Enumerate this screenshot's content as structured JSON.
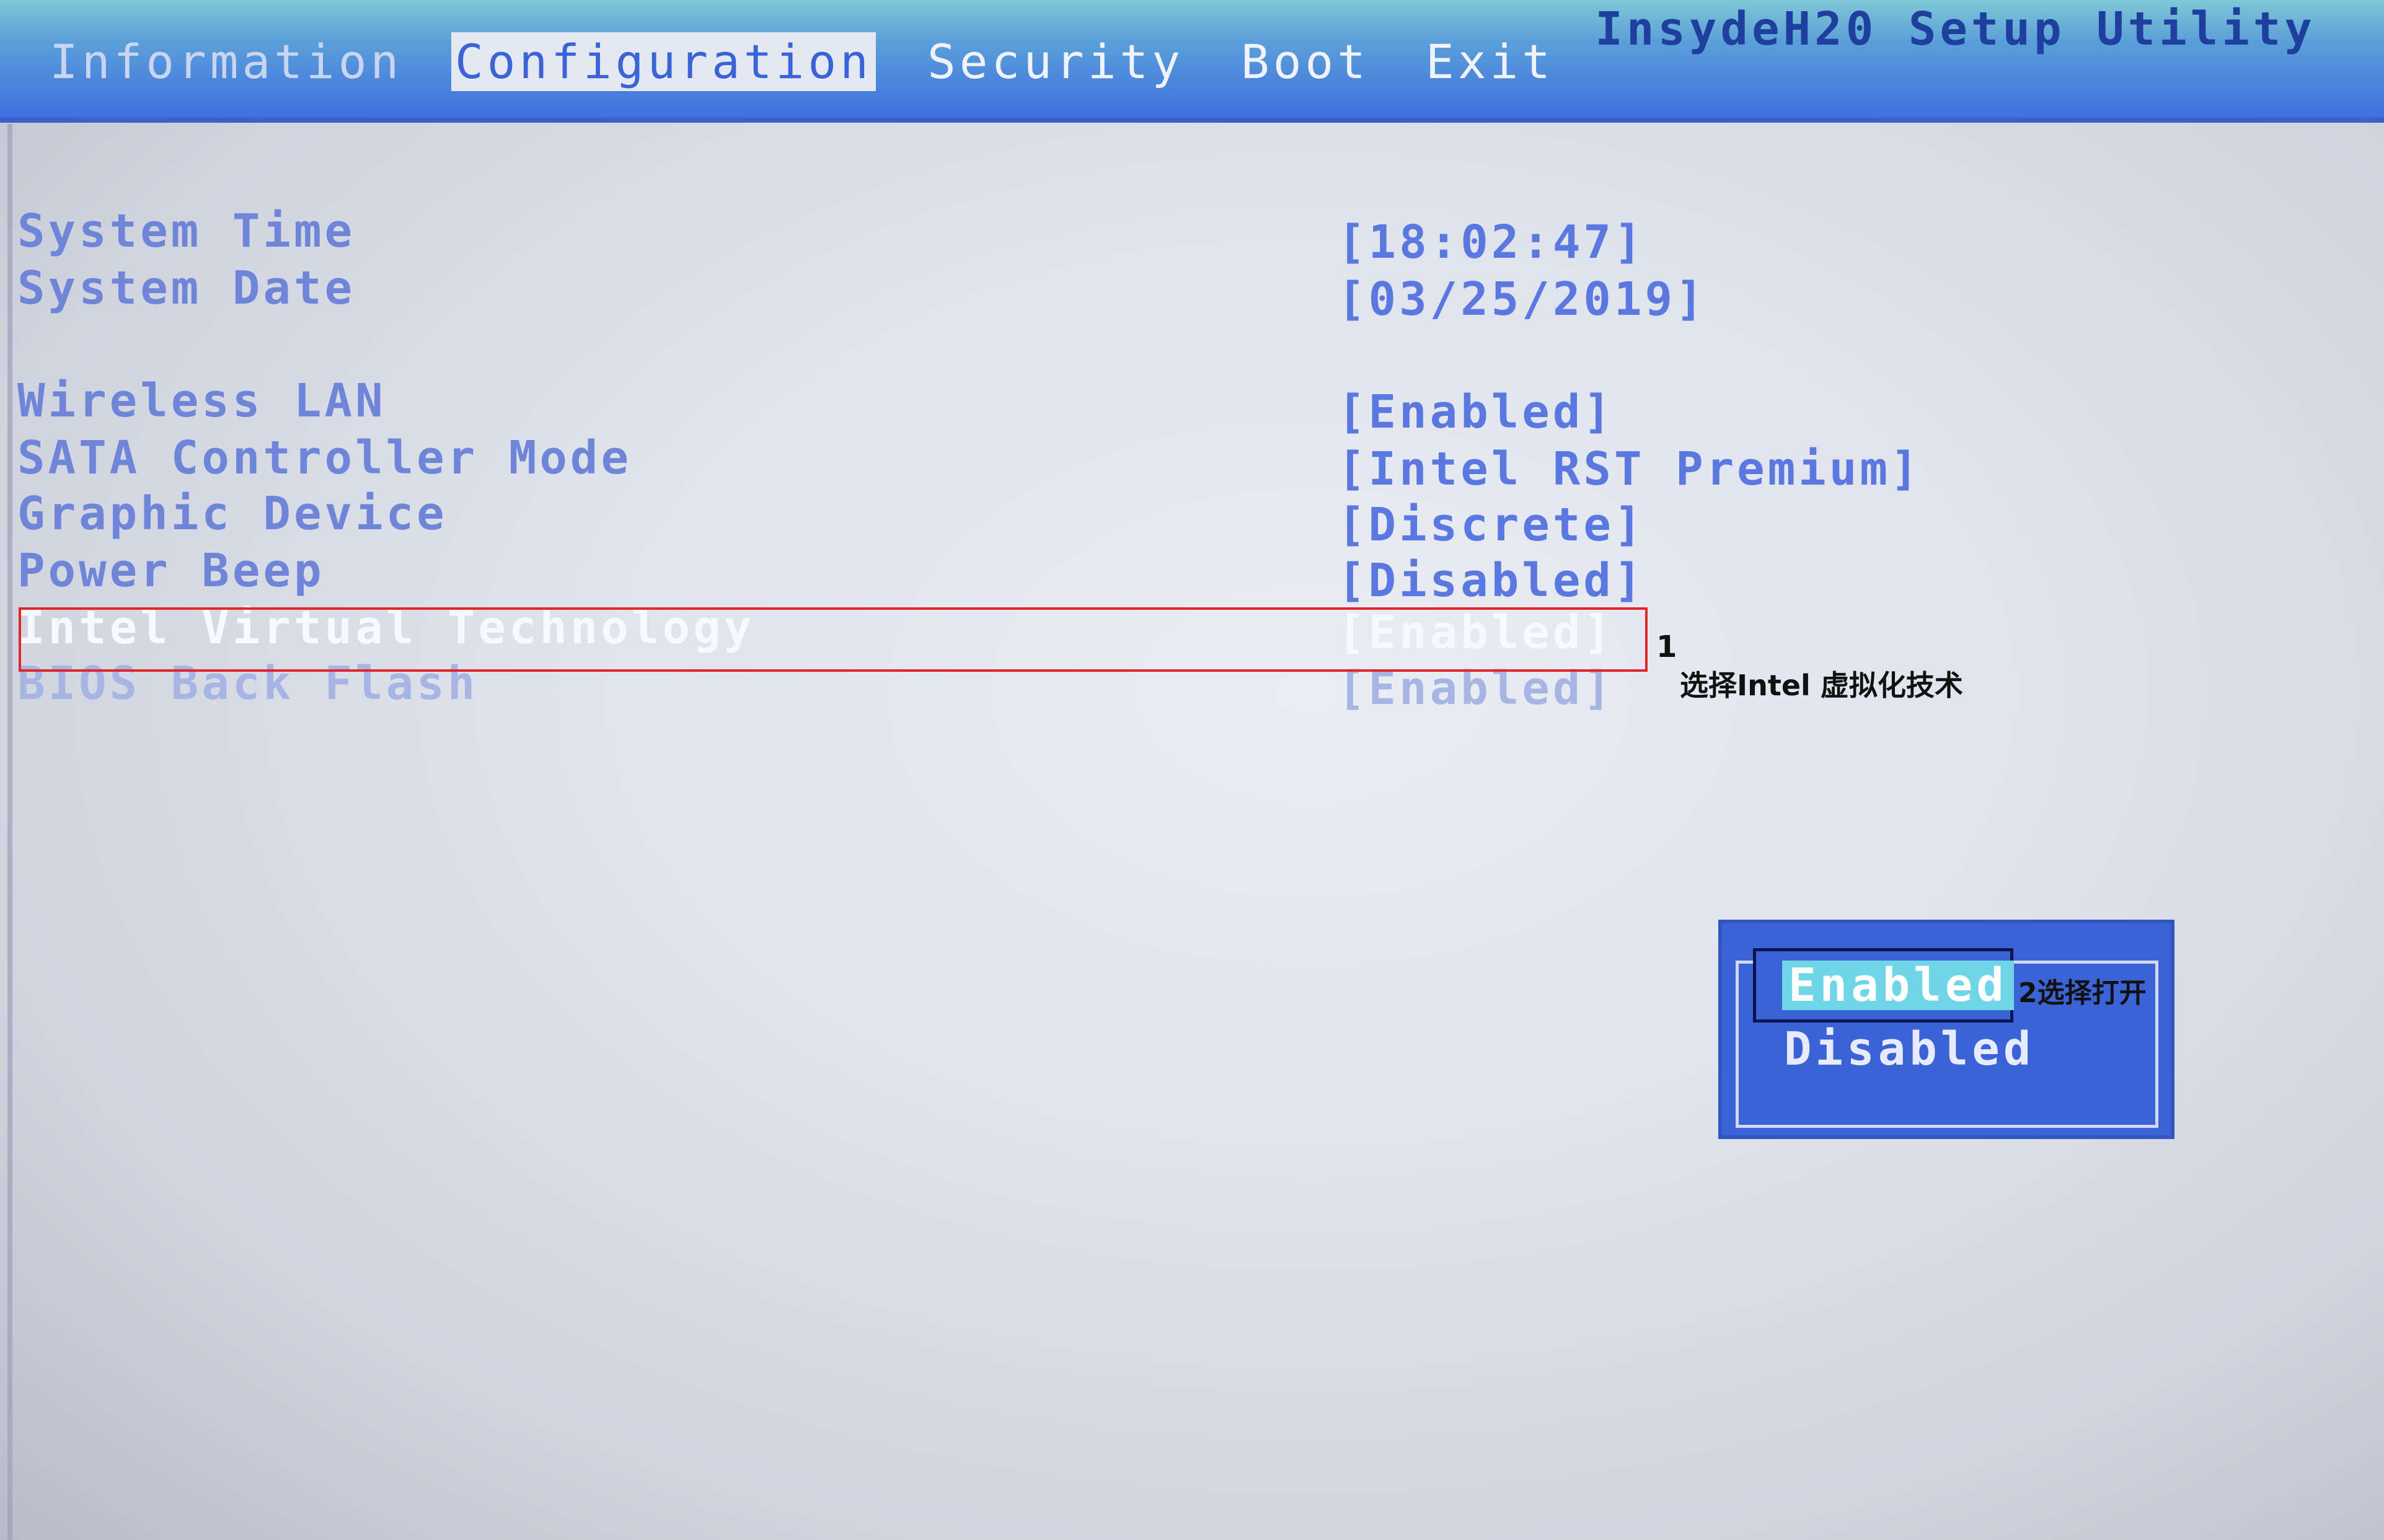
{
  "app_title": "InsydeH20 Setup Utility",
  "tabs": [
    {
      "label": "Information",
      "selected": false
    },
    {
      "label": "Configuration",
      "selected": true
    },
    {
      "label": "Security",
      "selected": false
    },
    {
      "label": "Boot",
      "selected": false
    },
    {
      "label": "Exit",
      "selected": false
    }
  ],
  "settings": [
    {
      "label": "System Time",
      "value": "[18:02:47]"
    },
    {
      "label": "System Date",
      "value": "[03/25/2019]"
    },
    {
      "label": "Wireless LAN",
      "value": "[Enabled]"
    },
    {
      "label": "SATA Controller Mode",
      "value": "[Intel RST Premium]"
    },
    {
      "label": "Graphic Device",
      "value": "[Discrete]"
    },
    {
      "label": "Power Beep",
      "value": "[Disabled]"
    },
    {
      "label": "Intel Virtual Technology",
      "value": "[Enabled]"
    },
    {
      "label": "BIOS Back Flash",
      "value": "[Enabled]"
    }
  ],
  "popup": {
    "options": [
      "Enabled",
      "Disabled"
    ],
    "selected": "Enabled"
  },
  "annotations": {
    "step1_number": "1",
    "step1_text": "选择Intel 虚拟化技术",
    "step2_text": "2选择打开"
  },
  "colors": {
    "highlight_box": "#e0282c",
    "setting_text": "#6f86d8",
    "popup_bg": "#3b63d6",
    "popup_selected_bg": "#6ed6e6"
  }
}
